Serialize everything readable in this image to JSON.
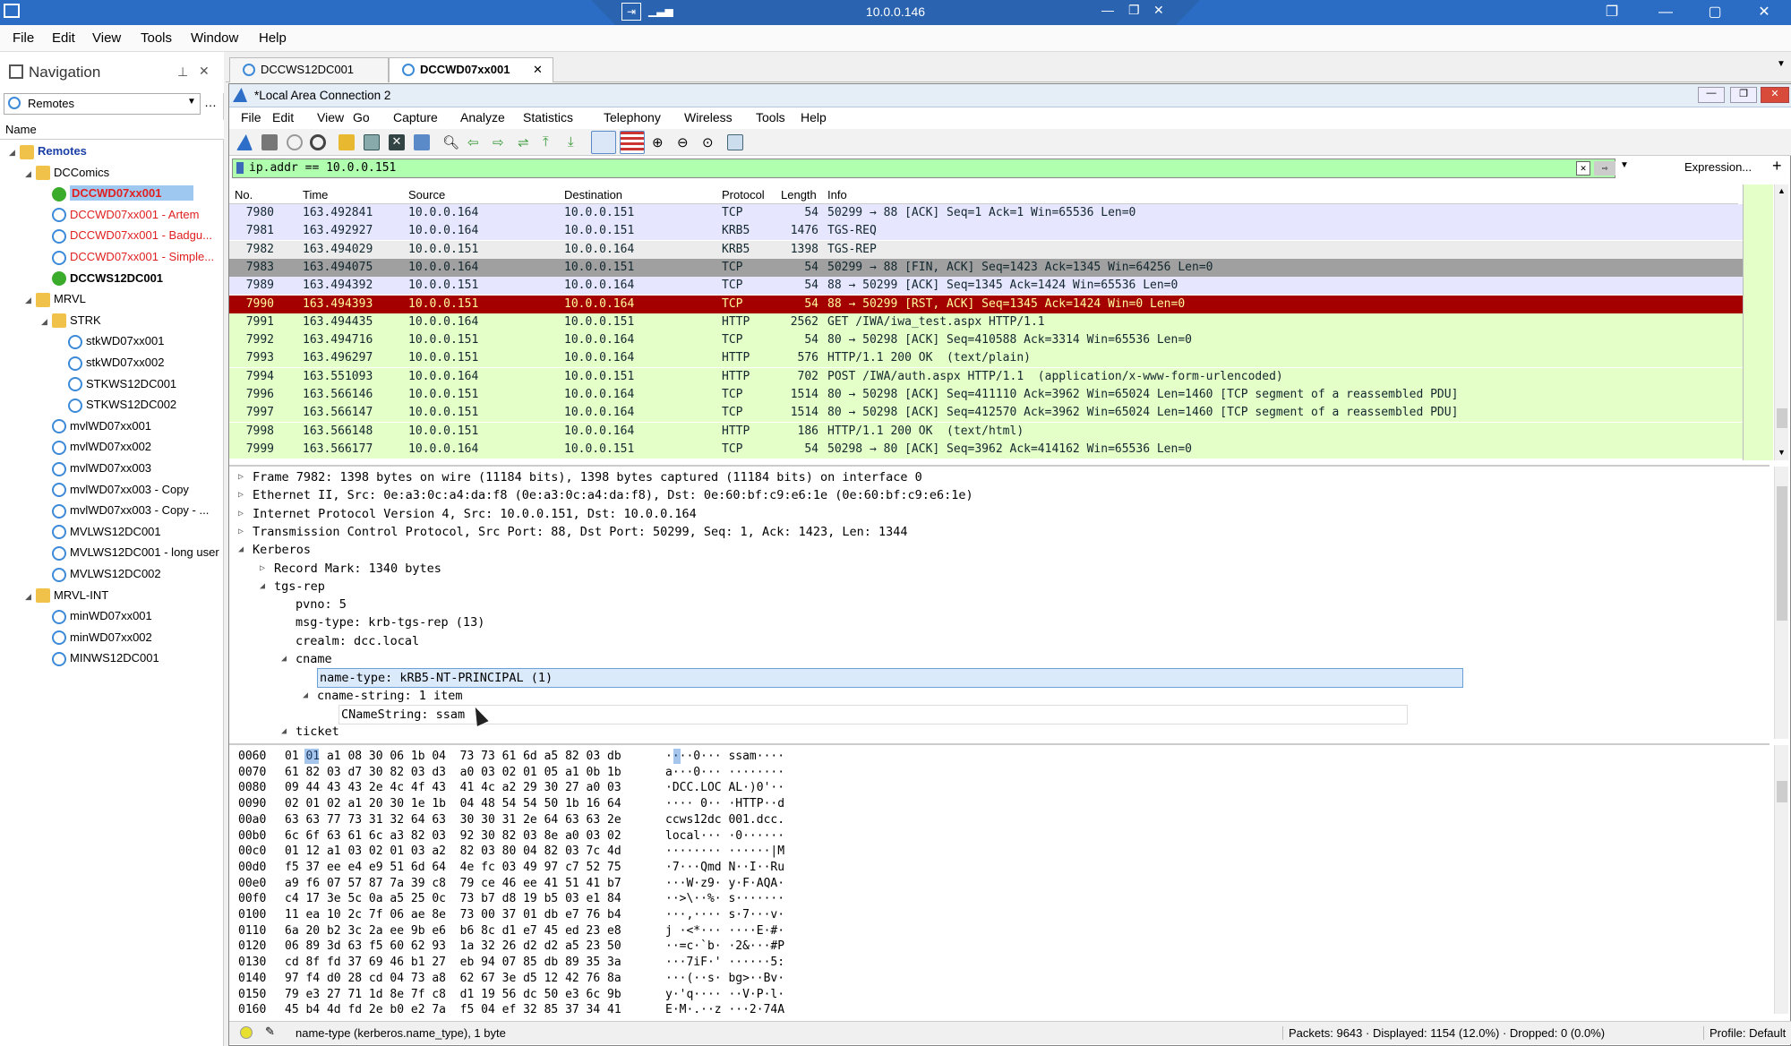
{
  "os": {
    "rdp_host": "10.0.0.146"
  },
  "app_menu": [
    "File",
    "Edit",
    "View",
    "Tools",
    "Window",
    "Help"
  ],
  "nav": {
    "title": "Navigation",
    "combo": "Remotes",
    "column": "Name",
    "tree": [
      {
        "label": "Remotes",
        "level": 0,
        "type": "folder",
        "style": "root"
      },
      {
        "label": "DCComics",
        "level": 1,
        "type": "folder",
        "style": "normal"
      },
      {
        "label": "DCCWD07xx001",
        "level": 2,
        "type": "play",
        "style": "selected"
      },
      {
        "label": "DCCWD07xx001 - Artem",
        "level": 2,
        "type": "rdp",
        "style": "red"
      },
      {
        "label": "DCCWD07xx001 - Badgu...",
        "level": 2,
        "type": "rdp",
        "style": "red"
      },
      {
        "label": "DCCWD07xx001 - Simple...",
        "level": 2,
        "type": "rdp",
        "style": "red"
      },
      {
        "label": "DCCWS12DC001",
        "level": 2,
        "type": "play",
        "style": "bold"
      },
      {
        "label": "MRVL",
        "level": 1,
        "type": "folder",
        "style": "normal"
      },
      {
        "label": "STRK",
        "level": 2,
        "type": "folder",
        "style": "normal"
      },
      {
        "label": "stkWD07xx001",
        "level": 3,
        "type": "rdp",
        "style": "normal"
      },
      {
        "label": "stkWD07xx002",
        "level": 3,
        "type": "rdp",
        "style": "normal"
      },
      {
        "label": "STKWS12DC001",
        "level": 3,
        "type": "rdp",
        "style": "normal"
      },
      {
        "label": "STKWS12DC002",
        "level": 3,
        "type": "rdp",
        "style": "normal"
      },
      {
        "label": "mvlWD07xx001",
        "level": 2,
        "type": "rdp",
        "style": "normal"
      },
      {
        "label": "mvlWD07xx002",
        "level": 2,
        "type": "rdp",
        "style": "normal"
      },
      {
        "label": "mvlWD07xx003",
        "level": 2,
        "type": "rdp",
        "style": "normal"
      },
      {
        "label": "mvlWD07xx003 - Copy",
        "level": 2,
        "type": "rdp",
        "style": "normal"
      },
      {
        "label": "mvlWD07xx003 - Copy - ...",
        "level": 2,
        "type": "rdp",
        "style": "normal"
      },
      {
        "label": "MVLWS12DC001",
        "level": 2,
        "type": "rdp",
        "style": "normal"
      },
      {
        "label": "MVLWS12DC001 - long user",
        "level": 2,
        "type": "rdp",
        "style": "normal"
      },
      {
        "label": "MVLWS12DC002",
        "level": 2,
        "type": "rdp",
        "style": "normal"
      },
      {
        "label": "MRVL-INT",
        "level": 1,
        "type": "folder",
        "style": "normal"
      },
      {
        "label": "minWD07xx001",
        "level": 2,
        "type": "rdp",
        "style": "normal"
      },
      {
        "label": "minWD07xx002",
        "level": 2,
        "type": "rdp",
        "style": "normal"
      },
      {
        "label": "MINWS12DC001",
        "level": 2,
        "type": "rdp",
        "style": "normal"
      }
    ]
  },
  "tabs": [
    {
      "label": "DCCWS12DC001",
      "active": false
    },
    {
      "label": "DCCWD07xx001",
      "active": true
    }
  ],
  "ws": {
    "title": "*Local Area Connection 2",
    "menu": [
      "File",
      "Edit",
      "View",
      "Go",
      "Capture",
      "Analyze",
      "Statistics",
      "Telephony",
      "Wireless",
      "Tools",
      "Help"
    ],
    "filter": "ip.addr == 10.0.0.151",
    "expression": "Expression...",
    "columns": [
      "No.",
      "Time",
      "Source",
      "Destination",
      "Protocol",
      "Length",
      "Info"
    ],
    "packets": [
      {
        "no": "7980",
        "time": "163.492841",
        "src": "10.0.0.164",
        "dst": "10.0.0.151",
        "proto": "TCP",
        "len": "54",
        "info": "50299 → 88 [ACK] Seq=1 Ack=1 Win=65536 Len=0",
        "bg": "#e7e6ff",
        "fg": "#12272e"
      },
      {
        "no": "7981",
        "time": "163.492927",
        "src": "10.0.0.164",
        "dst": "10.0.0.151",
        "proto": "KRB5",
        "len": "1476",
        "info": "TGS-REQ",
        "bg": "#e7e6ff",
        "fg": "#12272e"
      },
      {
        "no": "7982",
        "time": "163.494029",
        "src": "10.0.0.151",
        "dst": "10.0.0.164",
        "proto": "KRB5",
        "len": "1398",
        "info": "TGS-REP",
        "bg": "#ececec",
        "fg": "#12272e"
      },
      {
        "no": "7983",
        "time": "163.494075",
        "src": "10.0.0.164",
        "dst": "10.0.0.151",
        "proto": "TCP",
        "len": "54",
        "info": "50299 → 88 [FIN, ACK] Seq=1423 Ack=1345 Win=64256 Len=0",
        "bg": "#a0a0a0",
        "fg": "#12272e"
      },
      {
        "no": "7989",
        "time": "163.494392",
        "src": "10.0.0.151",
        "dst": "10.0.0.164",
        "proto": "TCP",
        "len": "54",
        "info": "88 → 50299 [ACK] Seq=1345 Ack=1424 Win=65536 Len=0",
        "bg": "#e7e6ff",
        "fg": "#12272e"
      },
      {
        "no": "7990",
        "time": "163.494393",
        "src": "10.0.0.151",
        "dst": "10.0.0.164",
        "proto": "TCP",
        "len": "54",
        "info": "88 → 50299 [RST, ACK] Seq=1345 Ack=1424 Win=0 Len=0",
        "bg": "#a40000",
        "fg": "#fffc9c"
      },
      {
        "no": "7991",
        "time": "163.494435",
        "src": "10.0.0.164",
        "dst": "10.0.0.151",
        "proto": "HTTP",
        "len": "2562",
        "info": "GET /IWA/iwa_test.aspx HTTP/1.1",
        "bg": "#e4ffc7",
        "fg": "#12272e"
      },
      {
        "no": "7992",
        "time": "163.494716",
        "src": "10.0.0.151",
        "dst": "10.0.0.164",
        "proto": "TCP",
        "len": "54",
        "info": "80 → 50298 [ACK] Seq=410588 Ack=3314 Win=65536 Len=0",
        "bg": "#e4ffc7",
        "fg": "#12272e"
      },
      {
        "no": "7993",
        "time": "163.496297",
        "src": "10.0.0.151",
        "dst": "10.0.0.164",
        "proto": "HTTP",
        "len": "576",
        "info": "HTTP/1.1 200 OK  (text/plain)",
        "bg": "#e4ffc7",
        "fg": "#12272e"
      },
      {
        "no": "7994",
        "time": "163.551093",
        "src": "10.0.0.164",
        "dst": "10.0.0.151",
        "proto": "HTTP",
        "len": "702",
        "info": "POST /IWA/auth.aspx HTTP/1.1  (application/x-www-form-urlencoded)",
        "bg": "#e4ffc7",
        "fg": "#12272e"
      },
      {
        "no": "7996",
        "time": "163.566146",
        "src": "10.0.0.151",
        "dst": "10.0.0.164",
        "proto": "TCP",
        "len": "1514",
        "info": "80 → 50298 [ACK] Seq=411110 Ack=3962 Win=65024 Len=1460 [TCP segment of a reassembled PDU]",
        "bg": "#e4ffc7",
        "fg": "#12272e"
      },
      {
        "no": "7997",
        "time": "163.566147",
        "src": "10.0.0.151",
        "dst": "10.0.0.164",
        "proto": "TCP",
        "len": "1514",
        "info": "80 → 50298 [ACK] Seq=412570 Ack=3962 Win=65024 Len=1460 [TCP segment of a reassembled PDU]",
        "bg": "#e4ffc7",
        "fg": "#12272e"
      },
      {
        "no": "7998",
        "time": "163.566148",
        "src": "10.0.0.151",
        "dst": "10.0.0.164",
        "proto": "HTTP",
        "len": "186",
        "info": "HTTP/1.1 200 OK  (text/html)",
        "bg": "#e4ffc7",
        "fg": "#12272e"
      },
      {
        "no": "7999",
        "time": "163.566177",
        "src": "10.0.0.164",
        "dst": "10.0.0.151",
        "proto": "TCP",
        "len": "54",
        "info": "50298 → 80 [ACK] Seq=3962 Ack=414162 Win=65536 Len=0",
        "bg": "#e4ffc7",
        "fg": "#12272e"
      }
    ],
    "details": [
      {
        "t": "Frame 7982: 1398 bytes on wire (11184 bits), 1398 bytes captured (11184 bits) on interface 0",
        "lv": 0,
        "ex": "closed"
      },
      {
        "t": "Ethernet II, Src: 0e:a3:0c:a4:da:f8 (0e:a3:0c:a4:da:f8), Dst: 0e:60:bf:c9:e6:1e (0e:60:bf:c9:e6:1e)",
        "lv": 0,
        "ex": "closed"
      },
      {
        "t": "Internet Protocol Version 4, Src: 10.0.0.151, Dst: 10.0.0.164",
        "lv": 0,
        "ex": "closed"
      },
      {
        "t": "Transmission Control Protocol, Src Port: 88, Dst Port: 50299, Seq: 1, Ack: 1423, Len: 1344",
        "lv": 0,
        "ex": "closed"
      },
      {
        "t": "Kerberos",
        "lv": 0,
        "ex": "open"
      },
      {
        "t": "Record Mark: 1340 bytes",
        "lv": 1,
        "ex": "closed"
      },
      {
        "t": "tgs-rep",
        "lv": 1,
        "ex": "open"
      },
      {
        "t": "pvno: 5",
        "lv": 2,
        "ex": "none"
      },
      {
        "t": "msg-type: krb-tgs-rep (13)",
        "lv": 2,
        "ex": "none"
      },
      {
        "t": "crealm: dcc.local",
        "lv": 2,
        "ex": "none"
      },
      {
        "t": "cname",
        "lv": 2,
        "ex": "open"
      },
      {
        "t": "name-type: kRB5-NT-PRINCIPAL (1)",
        "lv": 3,
        "ex": "none",
        "sel": true
      },
      {
        "t": "cname-string: 1 item",
        "lv": 3,
        "ex": "open"
      },
      {
        "t": "CNameString: ssam",
        "lv": 4,
        "ex": "none",
        "hl": true
      },
      {
        "t": "ticket",
        "lv": 2,
        "ex": "open"
      }
    ],
    "bytes": [
      {
        "o": "0060",
        "h": "01 01 a1 08 30 06 1b 04  73 73 61 6d a5 82 03 db",
        "a": "····0··· ssam····"
      },
      {
        "o": "0070",
        "h": "61 82 03 d7 30 82 03 d3  a0 03 02 01 05 a1 0b 1b",
        "a": "a···0··· ········"
      },
      {
        "o": "0080",
        "h": "09 44 43 43 2e 4c 4f 43  41 4c a2 29 30 27 a0 03",
        "a": "·DCC.LOC AL·)0'··"
      },
      {
        "o": "0090",
        "h": "02 01 02 a1 20 30 1e 1b  04 48 54 54 50 1b 16 64",
        "a": "···· 0·· ·HTTP··d"
      },
      {
        "o": "00a0",
        "h": "63 63 77 73 31 32 64 63  30 30 31 2e 64 63 63 2e",
        "a": "ccws12dc 001.dcc."
      },
      {
        "o": "00b0",
        "h": "6c 6f 63 61 6c a3 82 03  92 30 82 03 8e a0 03 02",
        "a": "local··· ·0······"
      },
      {
        "o": "00c0",
        "h": "01 12 a1 03 02 01 03 a2  82 03 80 04 82 03 7c 4d",
        "a": "········ ······|M"
      },
      {
        "o": "00d0",
        "h": "f5 37 ee e4 e9 51 6d 64  4e fc 03 49 97 c7 52 75",
        "a": "·7···Qmd N··I··Ru"
      },
      {
        "o": "00e0",
        "h": "a9 f6 07 57 87 7a 39 c8  79 ce 46 ee 41 51 41 b7",
        "a": "···W·z9· y·F·AQA·"
      },
      {
        "o": "00f0",
        "h": "c4 17 3e 5c 0a a5 25 0c  73 b7 d8 19 b5 03 e1 84",
        "a": "··>\\··%· s·······"
      },
      {
        "o": "0100",
        "h": "11 ea 10 2c 7f 06 ae 8e  73 00 37 01 db e7 76 b4",
        "a": "···,···· s·7···v·"
      },
      {
        "o": "0110",
        "h": "6a 20 b2 3c 2a ee 9b e6  b6 8c d1 e7 45 ed 23 e8",
        "a": "j ·<*··· ····E·#·"
      },
      {
        "o": "0120",
        "h": "06 89 3d 63 f5 60 62 93  1a 32 26 d2 d2 a5 23 50",
        "a": "··=c·`b· ·2&···#P"
      },
      {
        "o": "0130",
        "h": "cd 8f fd 37 69 46 b1 27  eb 94 07 85 db 89 35 3a",
        "a": "···7iF·' ······5:"
      },
      {
        "o": "0140",
        "h": "97 f4 d0 28 cd 04 73 a8  62 67 3e d5 12 42 76 8a",
        "a": "···(··s· bg>··Bv·"
      },
      {
        "o": "0150",
        "h": "79 e3 27 71 1d 8e 7f c8  d1 19 56 dc 50 e3 6c 9b",
        "a": "y·'q···· ··V·P·l·"
      },
      {
        "o": "0160",
        "h": "45 b4 4d fd 2e b0 e2 7a  f5 04 ef 32 85 37 34 41",
        "a": "E·M·.··z ···2·74A"
      }
    ],
    "status": {
      "field": "name-type (kerberos.name_type), 1 byte",
      "packets": "Packets: 9643 · Displayed: 1154 (12.0%) · Dropped: 0 (0.0%)",
      "profile": "Profile: Default"
    }
  }
}
